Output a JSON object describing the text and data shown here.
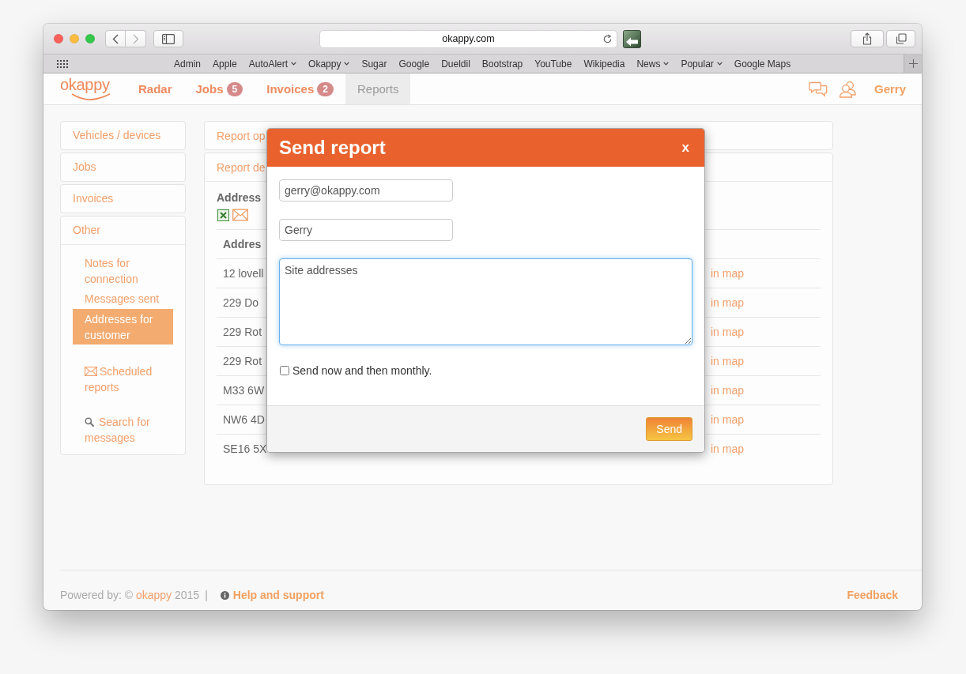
{
  "browser": {
    "url": "okappy.com",
    "bookmarks": [
      {
        "label": "Admin",
        "menu": false
      },
      {
        "label": "Apple",
        "menu": false
      },
      {
        "label": "AutoAlert",
        "menu": true
      },
      {
        "label": "Okappy",
        "menu": true
      },
      {
        "label": "Sugar",
        "menu": false
      },
      {
        "label": "Google",
        "menu": false
      },
      {
        "label": "Dueldil",
        "menu": false
      },
      {
        "label": "Bootstrap",
        "menu": false
      },
      {
        "label": "YouTube",
        "menu": false
      },
      {
        "label": "Wikipedia",
        "menu": false
      },
      {
        "label": "News",
        "menu": true
      },
      {
        "label": "Popular",
        "menu": true
      },
      {
        "label": "Google Maps",
        "menu": false
      }
    ]
  },
  "navbar": {
    "logo": "okappy",
    "items": [
      {
        "label": "Radar",
        "selected": false
      },
      {
        "label": "Jobs",
        "badge": "5",
        "selected": false
      },
      {
        "label": "Invoices",
        "badge": "2",
        "selected": false
      },
      {
        "label": "Reports",
        "selected": true
      }
    ],
    "user": "Gerry"
  },
  "sidebar": {
    "sections": [
      {
        "label": "Vehicles / devices",
        "expanded": false
      },
      {
        "label": "Jobs",
        "expanded": false
      },
      {
        "label": "Invoices",
        "expanded": false
      },
      {
        "label": "Other",
        "expanded": true,
        "children": [
          {
            "label": "Notes for connection",
            "kind": "link",
            "selected": false
          },
          {
            "label": "Messages sent",
            "kind": "link",
            "selected": false
          },
          {
            "label": "Addresses for customer",
            "kind": "link",
            "selected": true
          },
          {
            "label": "Scheduled reports",
            "kind": "mail",
            "selected": false
          },
          {
            "label": "Search for messages",
            "kind": "search",
            "selected": false
          }
        ]
      }
    ]
  },
  "main": {
    "panels": [
      {
        "title": "Report op"
      },
      {
        "title": "Report de",
        "report": {
          "heading": "Address",
          "columns": [
            "Addres"
          ],
          "rows": [
            {
              "address": "12 lovell",
              "action": "in map"
            },
            {
              "address": "229 Do",
              "action": "in map"
            },
            {
              "address": "229 Rot",
              "action": "in map"
            },
            {
              "address": "229 Rot",
              "action": "in map"
            },
            {
              "address": "M33 6W",
              "action": "in map"
            },
            {
              "address": "NW6 4D",
              "action": "in map"
            },
            {
              "address": "SE16 5X",
              "action": "in map"
            }
          ]
        }
      }
    ]
  },
  "modal": {
    "title": "Send report",
    "close": "x",
    "fields": [
      {
        "kind": "input",
        "value": "gerry@okappy.com",
        "focused": false
      },
      {
        "kind": "input",
        "value": "Gerry",
        "focused": false
      },
      {
        "kind": "textarea",
        "value": "Site addresses",
        "focused": true
      }
    ],
    "checkbox": {
      "label": "Send now and then monthly.",
      "checked": false
    },
    "button": "Send"
  },
  "footer": {
    "credit_before": "Powered by: ©",
    "credit_link": "okappy",
    "credit_after": "2015",
    "separator": "|",
    "help": "Help and support",
    "feedback": "Feedback"
  }
}
